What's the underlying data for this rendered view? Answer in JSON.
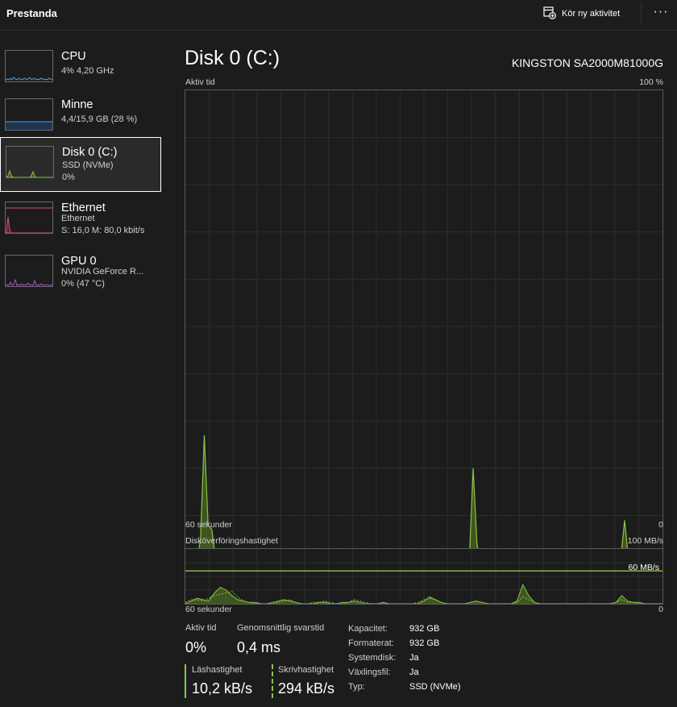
{
  "app": {
    "title": "Prestanda",
    "run_task_label": "Kör ny aktivitet",
    "more_label": "···"
  },
  "sidebar": {
    "items": [
      {
        "name": "CPU",
        "sub1": "4% 4,20 GHz",
        "sub2": "",
        "color": "#4fa3d9"
      },
      {
        "name": "Minne",
        "sub1": "4,4/15,9 GB (28 %)",
        "sub2": "",
        "color": "#4f9be0"
      },
      {
        "name": "Disk 0 (C:)",
        "sub1": "SSD (NVMe)",
        "sub2": "0%",
        "color": "#8bc34a"
      },
      {
        "name": "Ethernet",
        "sub1": "Ethernet",
        "sub2": "S: 16,0 M: 80,0 kbit/s",
        "color": "#e24a8a"
      },
      {
        "name": "GPU 0",
        "sub1": "NVIDIA GeForce R...",
        "sub2": "0% (47 °C)",
        "color": "#b04bd6"
      }
    ]
  },
  "main": {
    "title": "Disk 0 (C:)",
    "model": "KINGSTON SA2000M81000G",
    "active_graph": {
      "label": "Aktiv tid",
      "max_label": "100 %",
      "time_label": "60 sekunder",
      "min_label": "0"
    },
    "transfer_graph": {
      "label": "Disköverföringshastighet",
      "max_label": "100 MB/s",
      "line_label": "60 MB/s",
      "time_label": "60 sekunder",
      "min_label": "0"
    }
  },
  "stats": {
    "active_time": {
      "label": "Aktiv tid",
      "value": "0%"
    },
    "avg_response": {
      "label": "Genomsnittlig svarstid",
      "value": "0,4 ms"
    },
    "read_speed": {
      "label": "Läshastighet",
      "value": "10,2 kB/s"
    },
    "write_speed": {
      "label": "Skrivhastighet",
      "value": "294 kB/s"
    }
  },
  "info": [
    {
      "key": "Kapacitet:",
      "value": "932 GB"
    },
    {
      "key": "Formaterat:",
      "value": "932 GB"
    },
    {
      "key": "Systemdisk:",
      "value": "Ja"
    },
    {
      "key": "Växlingsfil:",
      "value": "Ja"
    },
    {
      "key": "Typ:",
      "value": "SSD (NVMe)"
    }
  ],
  "chart_data": [
    {
      "type": "area",
      "title": "Aktiv tid",
      "ylim": [
        0,
        100
      ],
      "x_range_seconds": 60,
      "series": [
        {
          "values": [
            3,
            1,
            0.5,
            0,
            5,
            27,
            8,
            7,
            0.5,
            0,
            0,
            0,
            0,
            0.5,
            0,
            0.5,
            0,
            0,
            0,
            0,
            0.5,
            0.5,
            0,
            0,
            0,
            0,
            0,
            0.5,
            0.5,
            0.5,
            0,
            0.5,
            0,
            0.5,
            0,
            0,
            0,
            0,
            0,
            0,
            0.5,
            0,
            0,
            0,
            0,
            0,
            1,
            1,
            0.5,
            0,
            0,
            0,
            0,
            0,
            0,
            0,
            0,
            0,
            0,
            0,
            0,
            0,
            0,
            0,
            0,
            0,
            0,
            0,
            0,
            0,
            0,
            0,
            0,
            0,
            0,
            1,
            20,
            4,
            0,
            0,
            0,
            0,
            0,
            0,
            0,
            0,
            0,
            0,
            0,
            0,
            0,
            0,
            0,
            0,
            0,
            0,
            0,
            0,
            0,
            0,
            0,
            0,
            0,
            0,
            0,
            0,
            0,
            0,
            0,
            0,
            0,
            0,
            1,
            0.5,
            0,
            1,
            9,
            1,
            1,
            0.5,
            1,
            0.5,
            0,
            0,
            0,
            0,
            0
          ]
        }
      ],
      "grid": true
    },
    {
      "type": "line",
      "title": "Disköverföringshastighet",
      "ylim": [
        0,
        100
      ],
      "x_range_seconds": 60,
      "reference_line": 60,
      "series": [
        {
          "values": [
            0,
            2,
            4,
            3,
            2,
            8,
            12,
            10,
            6,
            3,
            2,
            1,
            1,
            0,
            0,
            1,
            2,
            3,
            2,
            1,
            0,
            0,
            0,
            1,
            1,
            0,
            0,
            1,
            1,
            2,
            1,
            0,
            0,
            0,
            1,
            0,
            0,
            0,
            0,
            0,
            0,
            2,
            5,
            3,
            1,
            0,
            0,
            0,
            0,
            1,
            2,
            1,
            0,
            0,
            0,
            0,
            0,
            2,
            14,
            6,
            1,
            0,
            0,
            0,
            0,
            0,
            0,
            0,
            0,
            0,
            0,
            0,
            0,
            0,
            1,
            6,
            2,
            1,
            1,
            0,
            0,
            0,
            0
          ]
        },
        {
          "values": [
            1,
            3,
            3,
            2,
            4,
            6,
            7,
            8,
            9,
            5,
            2,
            1,
            0,
            0,
            0,
            0,
            1,
            2,
            3,
            1,
            0,
            0,
            1,
            1,
            2,
            1,
            0,
            0,
            1,
            3,
            2,
            1,
            0,
            0,
            0,
            0,
            0,
            0,
            0,
            0,
            1,
            3,
            4,
            3,
            1,
            0,
            0,
            0,
            0,
            1,
            2,
            1,
            0,
            0,
            0,
            0,
            0,
            1,
            5,
            3,
            1,
            0,
            0,
            0,
            0,
            0,
            0,
            0,
            0,
            0,
            0,
            0,
            0,
            0,
            1,
            3,
            1,
            1,
            0,
            0,
            0,
            0,
            0
          ]
        }
      ],
      "grid": true
    }
  ]
}
